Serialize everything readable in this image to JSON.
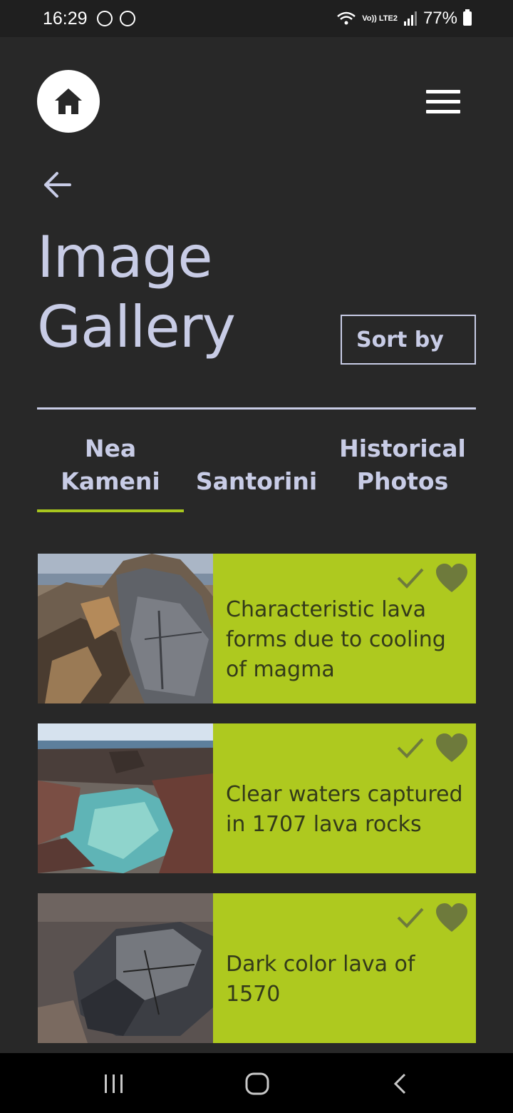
{
  "status_bar": {
    "time": "16:29",
    "network": "Vo)) LTE2",
    "battery": "77%"
  },
  "header": {
    "home_icon": "home-icon",
    "menu_icon": "hamburger-menu-icon"
  },
  "page": {
    "back_icon": "arrow-left-icon",
    "title": "Image Gallery",
    "sort_label": "Sort by"
  },
  "tabs": [
    {
      "label": "Nea\nKameni",
      "active": true
    },
    {
      "label": "Santorini",
      "active": false
    },
    {
      "label": "Historical\nPhotos",
      "active": false
    }
  ],
  "gallery": [
    {
      "caption": "Characteristic lava forms due to cooling of magma"
    },
    {
      "caption": "Clear waters captured in 1707 lava rocks"
    },
    {
      "caption": "Dark color lava of 1570"
    }
  ],
  "colors": {
    "background": "#282828",
    "title": "#c8cce6",
    "accent": "#aec91f",
    "icon_muted": "#6e7a3c"
  }
}
